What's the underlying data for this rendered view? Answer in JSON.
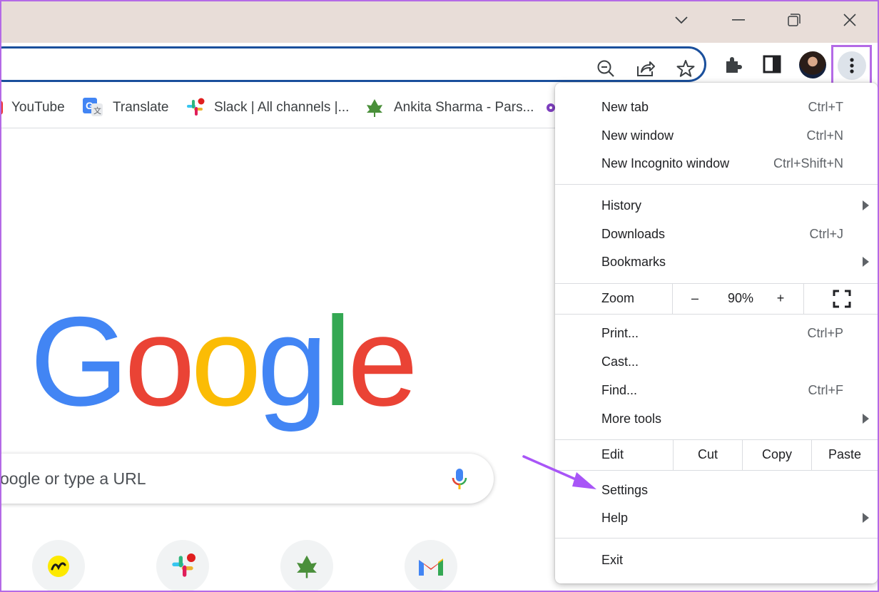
{
  "bookmarks": [
    {
      "label": "YouTube"
    },
    {
      "label": "Translate"
    },
    {
      "label": "Slack | All channels |..."
    },
    {
      "label": "Ankita Sharma - Pars..."
    }
  ],
  "search": {
    "placeholder": "oogle or type a URL"
  },
  "logo": {
    "letters": [
      "G",
      "o",
      "o",
      "g",
      "l",
      "e"
    ]
  },
  "colors": {
    "google_blue": "#4285f4",
    "google_red": "#ea4335",
    "google_yellow": "#fbbc05",
    "google_green": "#34a853",
    "highlight_purple": "#b46ae6",
    "omnibox_border": "#1a4f9c"
  },
  "menu": {
    "group1": [
      {
        "label": "New tab",
        "shortcut": "Ctrl+T"
      },
      {
        "label": "New window",
        "shortcut": "Ctrl+N"
      },
      {
        "label": "New Incognito window",
        "shortcut": "Ctrl+Shift+N"
      }
    ],
    "group2": [
      {
        "label": "History",
        "shortcut": ""
      },
      {
        "label": "Downloads",
        "shortcut": "Ctrl+J"
      },
      {
        "label": "Bookmarks",
        "shortcut": ""
      }
    ],
    "zoom": {
      "label": "Zoom",
      "minus": "–",
      "value": "90%",
      "plus": "+"
    },
    "group3": [
      {
        "label": "Print...",
        "shortcut": "Ctrl+P"
      },
      {
        "label": "Cast...",
        "shortcut": ""
      },
      {
        "label": "Find...",
        "shortcut": "Ctrl+F"
      },
      {
        "label": "More tools",
        "shortcut": ""
      }
    ],
    "edit": {
      "label": "Edit",
      "cut": "Cut",
      "copy": "Copy",
      "paste": "Paste"
    },
    "group4": [
      {
        "label": "Settings"
      },
      {
        "label": "Help"
      }
    ],
    "exit": {
      "label": "Exit"
    }
  }
}
